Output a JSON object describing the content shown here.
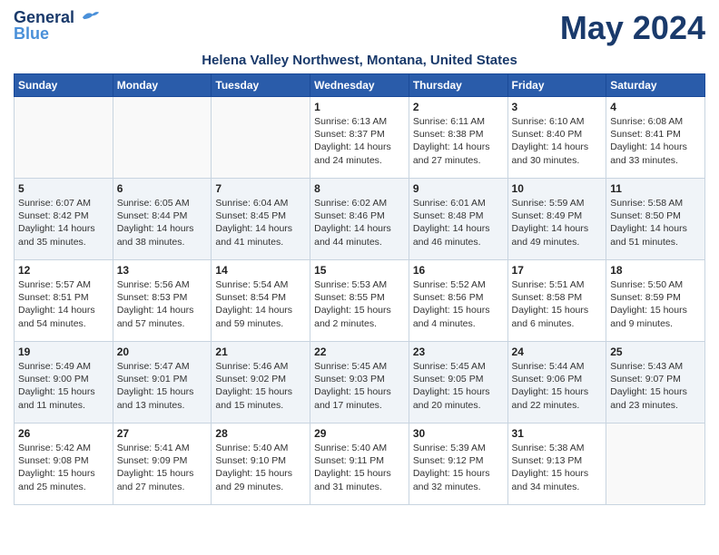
{
  "logo": {
    "line1": "General",
    "line2": "Blue",
    "icon": "🐦"
  },
  "month_title": "May 2024",
  "subtitle": "Helena Valley Northwest, Montana, United States",
  "days_of_week": [
    "Sunday",
    "Monday",
    "Tuesday",
    "Wednesday",
    "Thursday",
    "Friday",
    "Saturday"
  ],
  "weeks": [
    [
      {
        "day": "",
        "info": ""
      },
      {
        "day": "",
        "info": ""
      },
      {
        "day": "",
        "info": ""
      },
      {
        "day": "1",
        "info": "Sunrise: 6:13 AM\nSunset: 8:37 PM\nDaylight: 14 hours\nand 24 minutes."
      },
      {
        "day": "2",
        "info": "Sunrise: 6:11 AM\nSunset: 8:38 PM\nDaylight: 14 hours\nand 27 minutes."
      },
      {
        "day": "3",
        "info": "Sunrise: 6:10 AM\nSunset: 8:40 PM\nDaylight: 14 hours\nand 30 minutes."
      },
      {
        "day": "4",
        "info": "Sunrise: 6:08 AM\nSunset: 8:41 PM\nDaylight: 14 hours\nand 33 minutes."
      }
    ],
    [
      {
        "day": "5",
        "info": "Sunrise: 6:07 AM\nSunset: 8:42 PM\nDaylight: 14 hours\nand 35 minutes."
      },
      {
        "day": "6",
        "info": "Sunrise: 6:05 AM\nSunset: 8:44 PM\nDaylight: 14 hours\nand 38 minutes."
      },
      {
        "day": "7",
        "info": "Sunrise: 6:04 AM\nSunset: 8:45 PM\nDaylight: 14 hours\nand 41 minutes."
      },
      {
        "day": "8",
        "info": "Sunrise: 6:02 AM\nSunset: 8:46 PM\nDaylight: 14 hours\nand 44 minutes."
      },
      {
        "day": "9",
        "info": "Sunrise: 6:01 AM\nSunset: 8:48 PM\nDaylight: 14 hours\nand 46 minutes."
      },
      {
        "day": "10",
        "info": "Sunrise: 5:59 AM\nSunset: 8:49 PM\nDaylight: 14 hours\nand 49 minutes."
      },
      {
        "day": "11",
        "info": "Sunrise: 5:58 AM\nSunset: 8:50 PM\nDaylight: 14 hours\nand 51 minutes."
      }
    ],
    [
      {
        "day": "12",
        "info": "Sunrise: 5:57 AM\nSunset: 8:51 PM\nDaylight: 14 hours\nand 54 minutes."
      },
      {
        "day": "13",
        "info": "Sunrise: 5:56 AM\nSunset: 8:53 PM\nDaylight: 14 hours\nand 57 minutes."
      },
      {
        "day": "14",
        "info": "Sunrise: 5:54 AM\nSunset: 8:54 PM\nDaylight: 14 hours\nand 59 minutes."
      },
      {
        "day": "15",
        "info": "Sunrise: 5:53 AM\nSunset: 8:55 PM\nDaylight: 15 hours\nand 2 minutes."
      },
      {
        "day": "16",
        "info": "Sunrise: 5:52 AM\nSunset: 8:56 PM\nDaylight: 15 hours\nand 4 minutes."
      },
      {
        "day": "17",
        "info": "Sunrise: 5:51 AM\nSunset: 8:58 PM\nDaylight: 15 hours\nand 6 minutes."
      },
      {
        "day": "18",
        "info": "Sunrise: 5:50 AM\nSunset: 8:59 PM\nDaylight: 15 hours\nand 9 minutes."
      }
    ],
    [
      {
        "day": "19",
        "info": "Sunrise: 5:49 AM\nSunset: 9:00 PM\nDaylight: 15 hours\nand 11 minutes."
      },
      {
        "day": "20",
        "info": "Sunrise: 5:47 AM\nSunset: 9:01 PM\nDaylight: 15 hours\nand 13 minutes."
      },
      {
        "day": "21",
        "info": "Sunrise: 5:46 AM\nSunset: 9:02 PM\nDaylight: 15 hours\nand 15 minutes."
      },
      {
        "day": "22",
        "info": "Sunrise: 5:45 AM\nSunset: 9:03 PM\nDaylight: 15 hours\nand 17 minutes."
      },
      {
        "day": "23",
        "info": "Sunrise: 5:45 AM\nSunset: 9:05 PM\nDaylight: 15 hours\nand 20 minutes."
      },
      {
        "day": "24",
        "info": "Sunrise: 5:44 AM\nSunset: 9:06 PM\nDaylight: 15 hours\nand 22 minutes."
      },
      {
        "day": "25",
        "info": "Sunrise: 5:43 AM\nSunset: 9:07 PM\nDaylight: 15 hours\nand 23 minutes."
      }
    ],
    [
      {
        "day": "26",
        "info": "Sunrise: 5:42 AM\nSunset: 9:08 PM\nDaylight: 15 hours\nand 25 minutes."
      },
      {
        "day": "27",
        "info": "Sunrise: 5:41 AM\nSunset: 9:09 PM\nDaylight: 15 hours\nand 27 minutes."
      },
      {
        "day": "28",
        "info": "Sunrise: 5:40 AM\nSunset: 9:10 PM\nDaylight: 15 hours\nand 29 minutes."
      },
      {
        "day": "29",
        "info": "Sunrise: 5:40 AM\nSunset: 9:11 PM\nDaylight: 15 hours\nand 31 minutes."
      },
      {
        "day": "30",
        "info": "Sunrise: 5:39 AM\nSunset: 9:12 PM\nDaylight: 15 hours\nand 32 minutes."
      },
      {
        "day": "31",
        "info": "Sunrise: 5:38 AM\nSunset: 9:13 PM\nDaylight: 15 hours\nand 34 minutes."
      },
      {
        "day": "",
        "info": ""
      }
    ]
  ]
}
